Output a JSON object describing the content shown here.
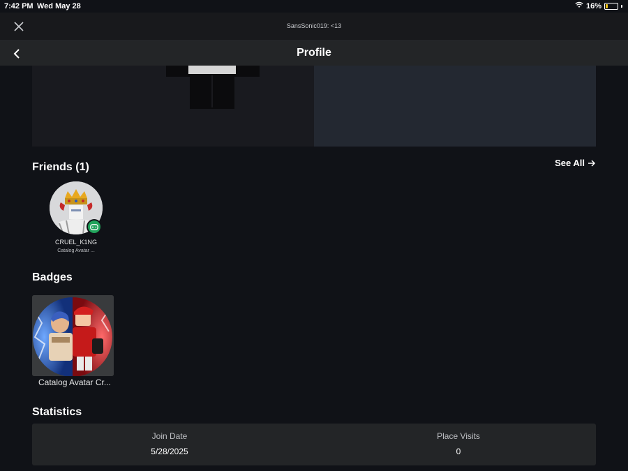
{
  "status_bar": {
    "time": "7:42 PM",
    "date": "Wed May 28",
    "battery_percent": "16%",
    "battery_level": 0.16,
    "battery_color": "#f0c419"
  },
  "top_bar": {
    "title": "SansSonic019: <13",
    "close_icon": "close-icon"
  },
  "nav": {
    "title": "Profile",
    "back_icon": "chevron-left-icon"
  },
  "friends": {
    "heading": "Friends (1)",
    "see_all": "See All",
    "items": [
      {
        "name": "CRUEL_K1NG",
        "status": "Catalog Avatar ...",
        "presence_color": "#21a35b"
      }
    ]
  },
  "badges": {
    "heading": "Badges",
    "items": [
      {
        "name": "Catalog Avatar Cr..."
      }
    ]
  },
  "statistics": {
    "heading": "Statistics",
    "join_date_label": "Join Date",
    "join_date_value": "5/28/2025",
    "place_visits_label": "Place Visits",
    "place_visits_value": "0"
  }
}
